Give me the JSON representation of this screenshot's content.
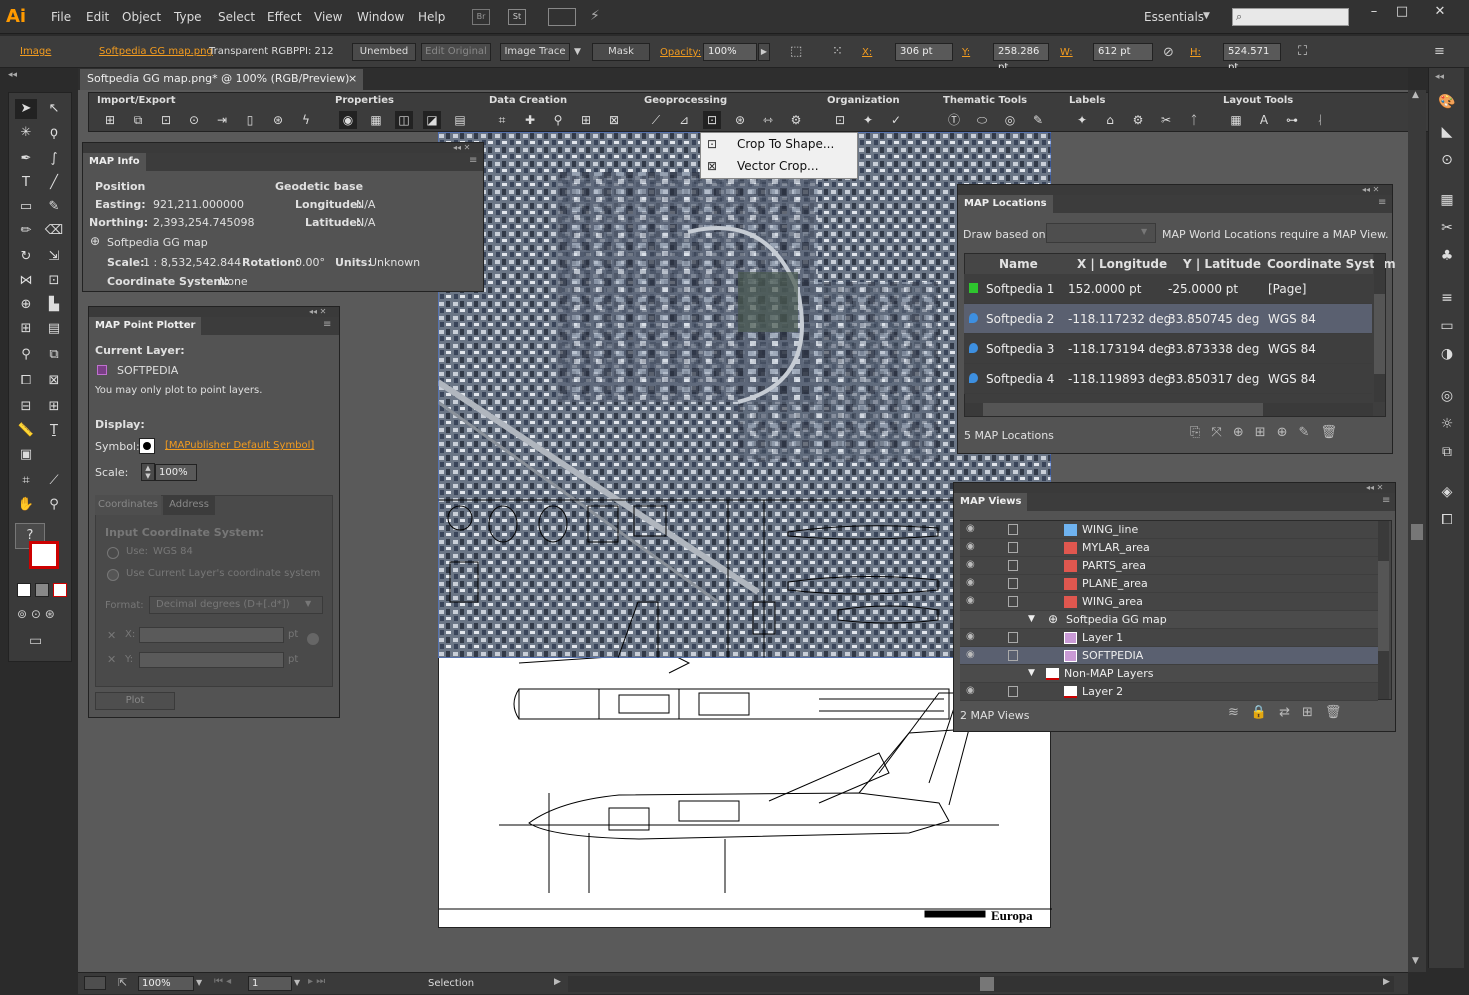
{
  "app": {
    "logo": "Ai",
    "workspace": "Essentials"
  },
  "menu": [
    "File",
    "Edit",
    "Object",
    "Type",
    "Select",
    "Effect",
    "View",
    "Window",
    "Help"
  ],
  "menubar_icons": {
    "bridge": "Br",
    "stock": "St"
  },
  "control": {
    "selection_type": "Image",
    "file_name": "Softpedia GG map.png",
    "color_mode": "Transparent RGB",
    "ppi": "PPI: 212",
    "embed_btn": "Unembed",
    "edit_original_btn": "Edit Original",
    "image_trace_btn": "Image Trace",
    "mask_btn": "Mask",
    "opacity_label": "Opacity:",
    "opacity_value": "100%",
    "x_label": "X:",
    "x_value": "306 pt",
    "y_label": "Y:",
    "y_value": "258.286 pt",
    "w_label": "W:",
    "w_value": "612 pt",
    "h_label": "H:",
    "h_value": "524.571 pt"
  },
  "document_tab": {
    "title": "Softpedia GG map.png* @ 100% (RGB/Preview)",
    "close": "×"
  },
  "map_toolbar": {
    "groups": [
      "Import/Export",
      "Properties",
      "Data Creation",
      "Geoprocessing",
      "Organization",
      "Thematic Tools",
      "Labels",
      "Layout Tools"
    ]
  },
  "crop_menu": {
    "items": [
      "Crop To Shape...",
      "Vector Crop..."
    ]
  },
  "map_info": {
    "tab": "MAP Info",
    "position_label": "Position",
    "geodetic_label": "Geodetic base",
    "easting_label": "Easting:",
    "easting_value": "921,211.000000",
    "northing_label": "Northing:",
    "northing_value": "2,393,254.745098",
    "longitude_label": "Longitude:",
    "longitude_value": "N/A",
    "latitude_label": "Latitude:",
    "latitude_value": "N/A",
    "map_name": "Softpedia GG map",
    "scale_label": "Scale:",
    "scale_value": "1 : 8,532,542.844",
    "rotation_label": "Rotation:",
    "rotation_value": "0.00°",
    "units_label": "Units:",
    "units_value": "Unknown",
    "cs_label": "Coordinate System:",
    "cs_value": "None"
  },
  "point_plotter": {
    "tab": "MAP Point Plotter",
    "current_layer_label": "Current Layer:",
    "current_layer": "SOFTPEDIA",
    "note": "You may only plot to point layers.",
    "display_label": "Display:",
    "symbol_label": "Symbol:",
    "symbol_name": "[MAPublisher Default Symbol]",
    "scale_label": "Scale:",
    "scale_value": "100%",
    "tab_coordinates": "Coordinates",
    "tab_address": "Address",
    "input_cs_label": "Input Coordinate System:",
    "use_label": "Use:",
    "use_value": "WGS 84",
    "use_current": "Use Current Layer's coordinate system",
    "format_label": "Format:",
    "format_value": "Decimal degrees (D+[.d*])",
    "x_label": "X:",
    "y_label": "Y:",
    "unit": "pt",
    "plot_btn": "Plot"
  },
  "map_locations": {
    "tab": "MAP Locations",
    "draw_label": "Draw based on:",
    "note": "MAP World Locations require a MAP View.",
    "columns": [
      "Name",
      "X | Longitude",
      "Y | Latitude",
      "Coordinate System"
    ],
    "rows": [
      {
        "name": "Softpedia 1",
        "x": "152.0000 pt",
        "y": "-25.0000 pt",
        "cs": "[Page]",
        "color": "#2ec52e"
      },
      {
        "name": "Softpedia 2",
        "x": "-118.117232 deg",
        "y": "33.850745 deg",
        "cs": "WGS 84",
        "color": "#3d8fe0"
      },
      {
        "name": "Softpedia 3",
        "x": "-118.173194 deg",
        "y": "33.873338 deg",
        "cs": "WGS 84",
        "color": "#3d8fe0"
      },
      {
        "name": "Softpedia 4",
        "x": "-118.119893 deg",
        "y": "33.850317 deg",
        "cs": "WGS 84",
        "color": "#3d8fe0"
      }
    ],
    "count": "5 MAP Locations"
  },
  "map_views": {
    "tab": "MAP Views",
    "rows": [
      {
        "label": "WING_line",
        "kind": "line"
      },
      {
        "label": "MYLAR_area",
        "kind": "area"
      },
      {
        "label": "PARTS_area",
        "kind": "area"
      },
      {
        "label": "PLANE_area",
        "kind": "area"
      },
      {
        "label": "WING_area",
        "kind": "area"
      },
      {
        "label": "Softpedia GG map",
        "kind": "view"
      },
      {
        "label": "Layer 1",
        "kind": "layer"
      },
      {
        "label": "SOFTPEDIA",
        "kind": "layer"
      },
      {
        "label": "Non-MAP Layers",
        "kind": "group"
      },
      {
        "label": "Layer 2",
        "kind": "nonmap"
      }
    ],
    "count": "2 MAP Views"
  },
  "artboard_text": {
    "brand": "Europa"
  },
  "status": {
    "zoom": "100%",
    "artboard": "1",
    "tool": "Selection"
  }
}
